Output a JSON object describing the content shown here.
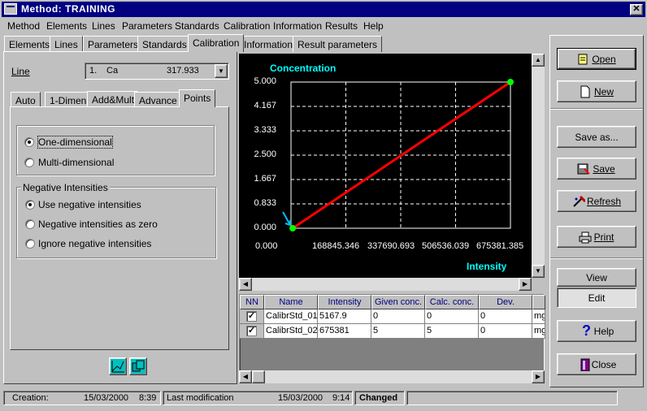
{
  "window": {
    "title": "Method:  TRAINING"
  },
  "menu": [
    "Method",
    "Elements",
    "Lines",
    "Parameters",
    "Standards",
    "Calibration",
    "Information",
    "Results",
    "Help"
  ],
  "main_tabs": [
    "Elements",
    "Lines",
    "Parameters",
    "Standards",
    "Calibration",
    "Information",
    "Result parameters"
  ],
  "line_field": {
    "label": "Line",
    "index": "1.",
    "element": "Ca",
    "wavelength": "317.933"
  },
  "sub_tabs": [
    "Auto",
    "1-Dimen",
    "Add&Mult",
    "Advance",
    "Points"
  ],
  "dimension": {
    "options": [
      "One-dimensional",
      "Multi-dimensional"
    ],
    "selected": "One-dimensional"
  },
  "negative": {
    "group_label": "Negative Intensities",
    "options": [
      "Use negative intensities",
      "Negative intensities as zero",
      "Ignore negative intensities"
    ],
    "selected": "Use negative intensities"
  },
  "chart_data": {
    "type": "line",
    "title": "",
    "ylabel": "Concentration",
    "xlabel": "Intensity",
    "ylim": [
      0,
      5
    ],
    "xlim": [
      0,
      675381.385
    ],
    "y_ticks": [
      "5.000",
      "4.167",
      "3.333",
      "2.500",
      "1.667",
      "0.833",
      "0.000"
    ],
    "x_ticks": [
      "0.000",
      "168845.346",
      "337690.693",
      "506536.039",
      "675381.385"
    ],
    "points": [
      {
        "x": 5167.9,
        "y": 0
      },
      {
        "x": 675381,
        "y": 5
      }
    ],
    "line_color": "#ff0000",
    "point_color": "#00ff00",
    "label_color": "#00ffff",
    "grid": true
  },
  "table": {
    "columns": [
      "NN",
      "Name",
      "Intensity",
      "Given conc.",
      "Calc. conc.",
      "Dev."
    ],
    "rows": [
      {
        "checked": true,
        "name": "CalibrStd_01",
        "intensity": "5167.9",
        "given": "0",
        "calc": "0",
        "dev": "0",
        "unit": "mg"
      },
      {
        "checked": true,
        "name": "CalibrStd_02",
        "intensity": "675381",
        "given": "5",
        "calc": "5",
        "dev": "0",
        "unit": "mg"
      }
    ]
  },
  "buttons": {
    "open": "Open",
    "new": "New",
    "save_as": "Save as...",
    "save": "Save",
    "refresh": "Refresh",
    "print": "Print",
    "view": "View",
    "edit": "Edit",
    "help": "Help",
    "close": "Close"
  },
  "status": {
    "creation_label": "Creation:",
    "creation_date": "15/03/2000",
    "creation_time": "8:39",
    "mod_label": "Last modification",
    "mod_date": "15/03/2000",
    "mod_time": "9:14",
    "state": "Changed"
  }
}
